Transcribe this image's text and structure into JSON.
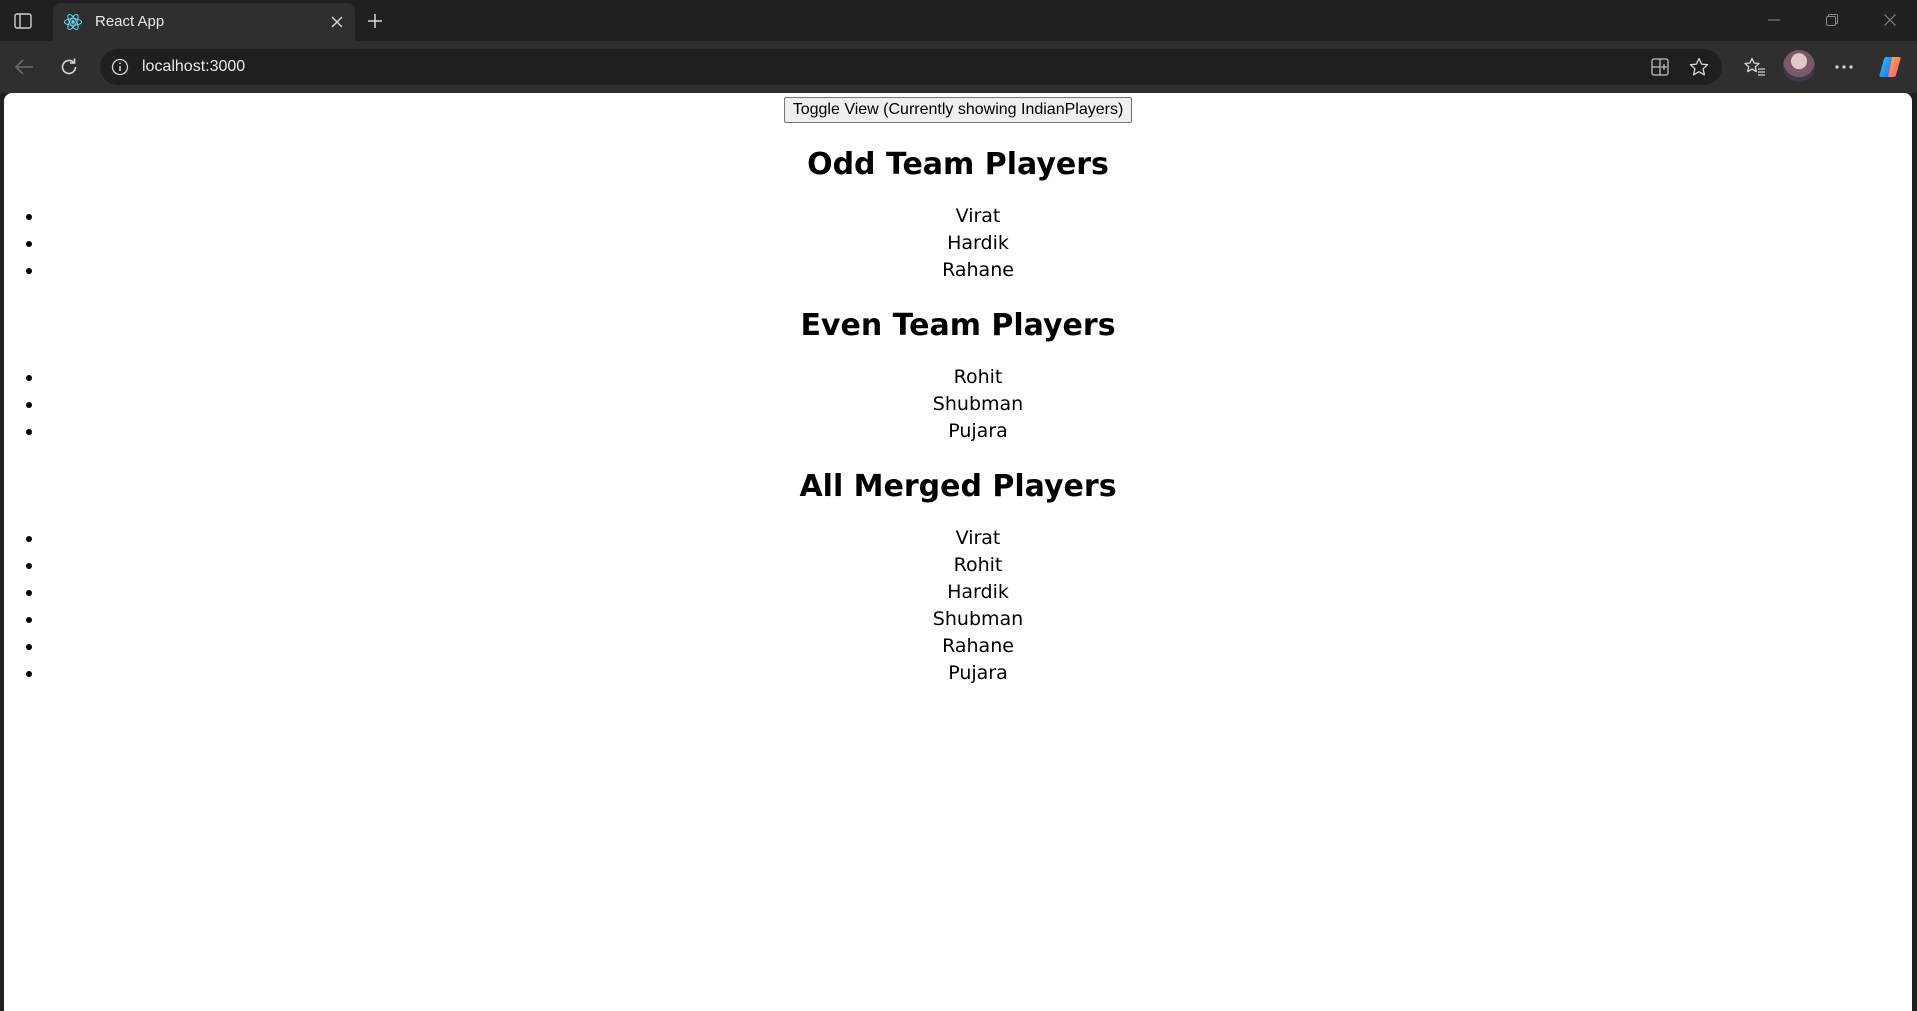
{
  "browser": {
    "tab_title": "React App",
    "url": "localhost:3000"
  },
  "page": {
    "toggle_button": "Toggle View (Currently showing IndianPlayers)",
    "odd": {
      "heading": "Odd Team Players",
      "players": [
        "Virat",
        "Hardik",
        "Rahane"
      ]
    },
    "even": {
      "heading": "Even Team Players",
      "players": [
        "Rohit",
        "Shubman",
        "Pujara"
      ]
    },
    "merged": {
      "heading": "All Merged Players",
      "players": [
        "Virat",
        "Rohit",
        "Hardik",
        "Shubman",
        "Rahane",
        "Pujara"
      ]
    }
  },
  "icons": {
    "sidebar": "sidebar-icon",
    "favicon": "react-logo-icon",
    "tab_close": "close-icon",
    "new_tab": "plus-icon",
    "back": "arrow-left-icon",
    "reload": "reload-icon",
    "info": "info-icon",
    "apps": "app-available-icon",
    "favorite": "star-icon",
    "favorites": "favorites-icon",
    "more": "more-icon",
    "copilot": "copilot-icon"
  }
}
